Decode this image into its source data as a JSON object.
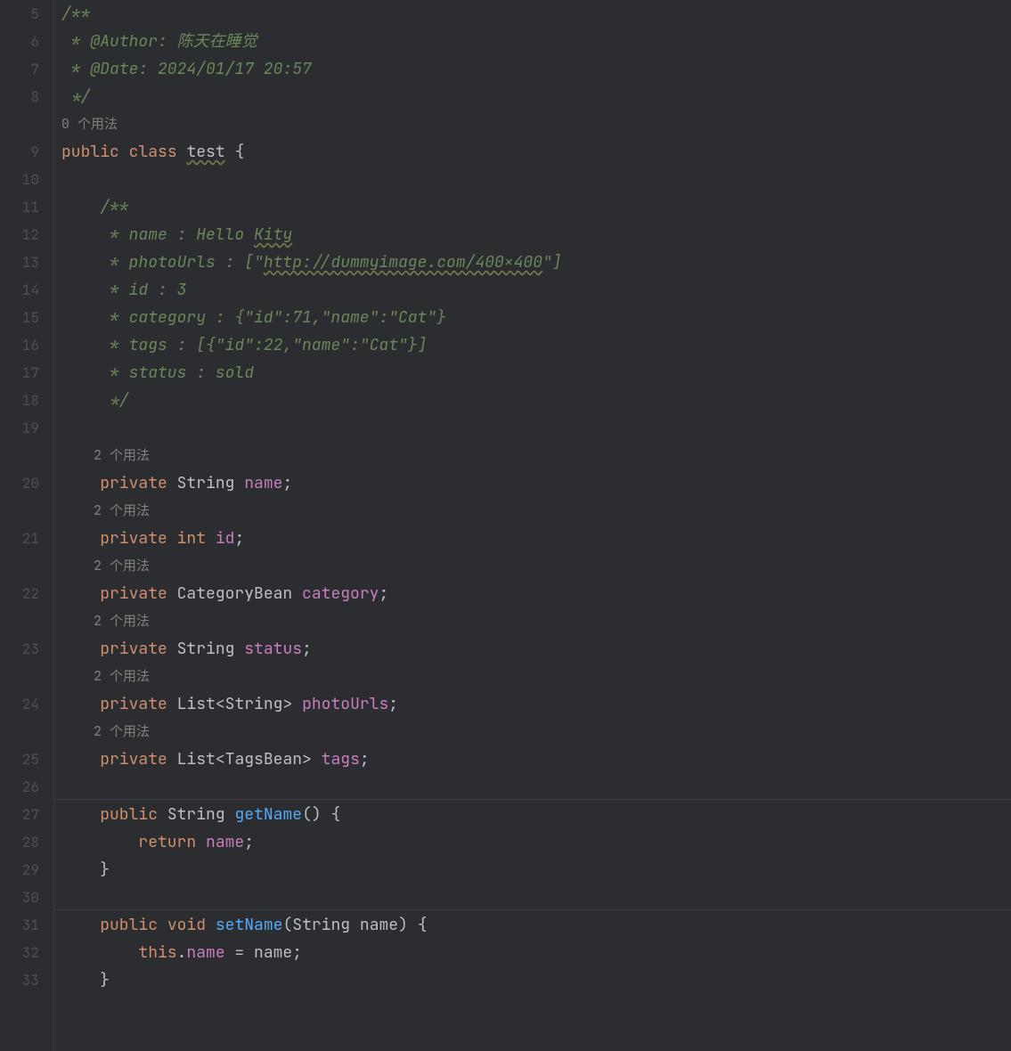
{
  "gutter": {
    "start": 5,
    "numbers": [
      5,
      6,
      7,
      8,
      null,
      9,
      10,
      11,
      12,
      13,
      14,
      15,
      16,
      17,
      18,
      19,
      null,
      20,
      null,
      21,
      null,
      22,
      null,
      23,
      null,
      24,
      null,
      25,
      26,
      27,
      28,
      29,
      30,
      31,
      32,
      33
    ]
  },
  "hints": {
    "usages0": "0 个用法",
    "usages2": "2 个用法"
  },
  "code": {
    "l5": "/**",
    "l6a": " * @Author: ",
    "l6b": "陈天在睡觉",
    "l7": " * @Date: 2024/01/17 20:57",
    "l8": " */",
    "l9_public": "public",
    "l9_class": "class",
    "l9_name": "test",
    "l9_brace": " {",
    "l11": "/**",
    "l12a": " * name : Hello ",
    "l12b": "Kity",
    "l13a": " * photoUrls : [\"",
    "l13b": "http://dummyimage.com/400x400",
    "l13c": "\"]",
    "l14": " * id : 3",
    "l15": " * category : {\"id\":71,\"name\":\"Cat\"}",
    "l16": " * tags : [{\"id\":22,\"name\":\"Cat\"}]",
    "l17": " * status : sold",
    "l18": " */",
    "priv": "private",
    "tString": "String",
    "tInt": "int",
    "tCategoryBean": "CategoryBean",
    "tList": "List",
    "tTagsBean": "TagsBean",
    "fName": "name",
    "fId": "id",
    "fCategory": "category",
    "fStatus": "status",
    "fPhotoUrls": "photoUrls",
    "fTags": "tags",
    "semi": ";",
    "lt": "<",
    "gt": ">",
    "pub": "public",
    "void": "void",
    "mGetName": "getName",
    "mSetName": "setName",
    "parenO": "(",
    "parenC": ")",
    "braceO": "{",
    "braceC": "}",
    "ret": "return",
    "kthis": "this",
    "dot": ".",
    "eq": " = ",
    "paramName": "name"
  }
}
